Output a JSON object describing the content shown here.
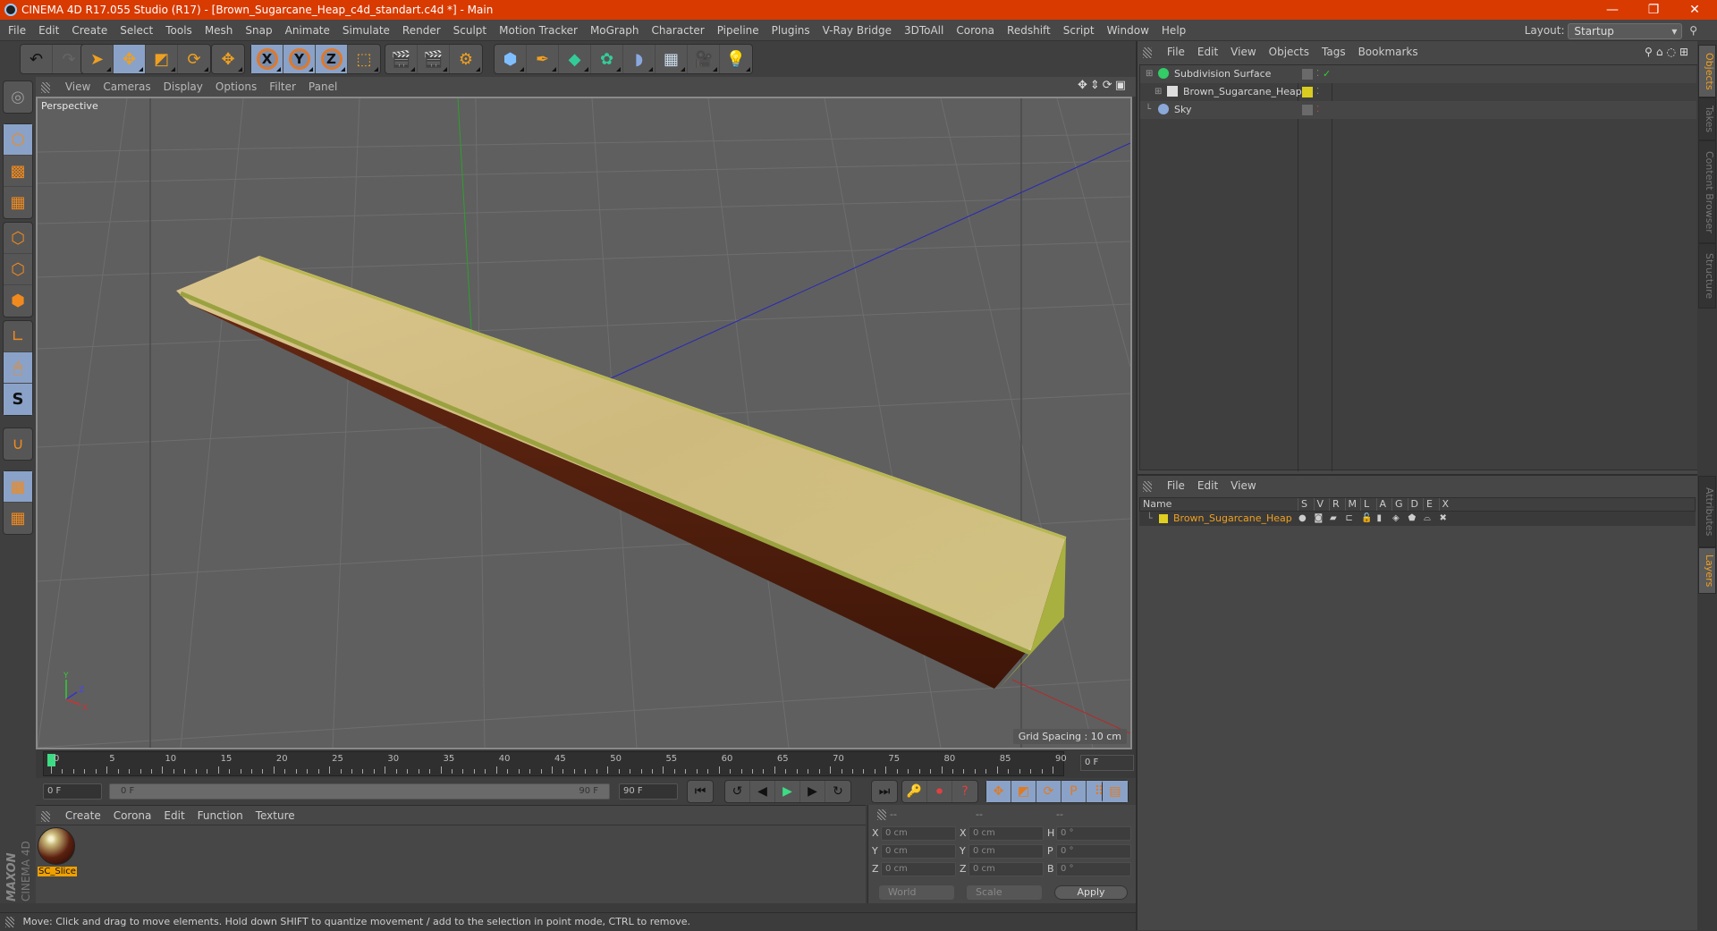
{
  "window": {
    "title": "CINEMA 4D R17.055 Studio (R17) - [Brown_Sugarcane_Heap_c4d_standart.c4d *] - Main",
    "controls": {
      "minimize": "—",
      "restore": "❐",
      "close": "✕"
    }
  },
  "menubar": {
    "items": [
      "File",
      "Edit",
      "Create",
      "Select",
      "Tools",
      "Mesh",
      "Snap",
      "Animate",
      "Simulate",
      "Render",
      "Sculpt",
      "Motion Tracker",
      "MoGraph",
      "Character",
      "Pipeline",
      "Plugins",
      "V-Ray Bridge",
      "3DToAll",
      "Corona",
      "Redshift",
      "Script",
      "Window",
      "Help"
    ],
    "layout_label": "Layout:",
    "layout_value": "Startup"
  },
  "toolbar": {
    "groups": [
      [
        {
          "icon": "undo-icon",
          "glyph": "↶"
        },
        {
          "icon": "redo-icon",
          "glyph": "↷"
        }
      ],
      [
        {
          "icon": "live-selection-icon",
          "glyph": "➤",
          "active": false
        },
        {
          "icon": "move-icon",
          "glyph": "✥",
          "active": true
        },
        {
          "icon": "scale-icon",
          "glyph": "◩",
          "active": false
        },
        {
          "icon": "rotate-icon",
          "glyph": "⟳",
          "active": false
        }
      ],
      [
        {
          "icon": "recent-tool-icon",
          "glyph": "✥"
        }
      ],
      [
        {
          "icon": "x-axis-lock-icon",
          "glyph": "X",
          "active": true
        },
        {
          "icon": "y-axis-lock-icon",
          "glyph": "Y",
          "active": true
        },
        {
          "icon": "z-axis-lock-icon",
          "glyph": "Z",
          "active": true
        },
        {
          "icon": "coordinate-system-icon",
          "glyph": "⬚"
        }
      ],
      [
        {
          "icon": "render-view-icon",
          "glyph": "🎬"
        },
        {
          "icon": "render-picture-viewer-icon",
          "glyph": "🎬"
        },
        {
          "icon": "render-settings-icon",
          "glyph": "⚙"
        }
      ],
      [
        {
          "icon": "cube-icon",
          "glyph": "⬢"
        },
        {
          "icon": "pen-spline-icon",
          "glyph": "✒"
        },
        {
          "icon": "subdivision-surface-icon",
          "glyph": "◆"
        },
        {
          "icon": "cloner-icon",
          "glyph": "✿"
        },
        {
          "icon": "deformer-bend-icon",
          "glyph": "◗"
        },
        {
          "icon": "floor-icon",
          "glyph": "▦"
        },
        {
          "icon": "camera-icon",
          "glyph": "🎥"
        },
        {
          "icon": "light-icon",
          "glyph": "💡"
        }
      ]
    ]
  },
  "left_tools": {
    "groups": [
      [
        {
          "icon": "make-editable-icon",
          "glyph": "◎"
        }
      ],
      [
        {
          "icon": "model-mode-icon",
          "glyph": "⬡",
          "active": true
        },
        {
          "icon": "texture-mode-icon",
          "glyph": "▩"
        },
        {
          "icon": "workplane-mode-icon",
          "glyph": "▦"
        }
      ],
      [
        {
          "icon": "points-mode-icon",
          "glyph": "⬡"
        },
        {
          "icon": "edges-mode-icon",
          "glyph": "⬡"
        },
        {
          "icon": "polygons-mode-icon",
          "glyph": "⬢"
        }
      ],
      [
        {
          "icon": "axis-mode-icon",
          "glyph": "∟"
        },
        {
          "icon": "tweak-mode-icon",
          "glyph": "🖱",
          "active": true
        },
        {
          "icon": "snapping-icon",
          "glyph": "S",
          "active": true
        }
      ],
      [
        {
          "icon": "magnet-icon",
          "glyph": "∪"
        }
      ],
      [
        {
          "icon": "locked-workplane-icon",
          "glyph": "▦",
          "active": true
        },
        {
          "icon": "planar-workplane-icon",
          "glyph": "▦"
        }
      ]
    ]
  },
  "viewport": {
    "menu": [
      "View",
      "Cameras",
      "Display",
      "Options",
      "Filter",
      "Panel"
    ],
    "label": "Perspective",
    "grid_spacing": "Grid Spacing : 10 cm",
    "nav_icons": [
      "move-view-icon",
      "zoom-view-icon",
      "rotate-view-icon",
      "maximize-view-icon"
    ],
    "axis_labels": {
      "x": "X",
      "y": "Y",
      "z": "Z"
    }
  },
  "timeline": {
    "ticks": [
      "0",
      "5",
      "10",
      "15",
      "20",
      "25",
      "30",
      "35",
      "40",
      "45",
      "50",
      "55",
      "60",
      "65",
      "70",
      "75",
      "80",
      "85",
      "90"
    ],
    "current_frame": "0 F",
    "start_field": "0 F",
    "range_start": "0 F",
    "range_end": "90 F",
    "end_field": "90 F"
  },
  "transport": {
    "buttons": [
      {
        "name": "go-to-start-button",
        "glyph": "⏮"
      },
      {
        "name": "previous-keyframe-button",
        "glyph": "↺"
      },
      {
        "name": "previous-frame-button",
        "glyph": "◀"
      },
      {
        "name": "play-button",
        "glyph": "▶"
      },
      {
        "name": "next-frame-button",
        "glyph": "▶"
      },
      {
        "name": "next-keyframe-button",
        "glyph": "↻"
      },
      {
        "name": "go-to-end-button",
        "glyph": "⏭"
      },
      {
        "name": "record-motion-button",
        "glyph": "🔑"
      },
      {
        "name": "autokeying-button",
        "glyph": "⏺"
      },
      {
        "name": "keyframe-selection-button",
        "glyph": "?"
      },
      {
        "name": "key-position-button",
        "glyph": "✥"
      },
      {
        "name": "key-scale-button",
        "glyph": "◩"
      },
      {
        "name": "key-rotation-button",
        "glyph": "⟳"
      },
      {
        "name": "key-parameter-button",
        "glyph": "P"
      },
      {
        "name": "key-pla-button",
        "glyph": "⠿"
      },
      {
        "name": "timeline-button",
        "glyph": "▤"
      }
    ]
  },
  "material_manager": {
    "menu": [
      "Create",
      "Corona",
      "Edit",
      "Function",
      "Texture"
    ],
    "materials": [
      {
        "name": "SC_Slice"
      }
    ]
  },
  "coordinates": {
    "headers": [
      "--",
      "--",
      "--"
    ],
    "rows": [
      {
        "l1": "X",
        "v1": "0 cm",
        "l2": "X",
        "v2": "0 cm",
        "l3": "H",
        "v3": "0 °"
      },
      {
        "l1": "Y",
        "v1": "0 cm",
        "l2": "Y",
        "v2": "0 cm",
        "l3": "P",
        "v3": "0 °"
      },
      {
        "l1": "Z",
        "v1": "0 cm",
        "l2": "Z",
        "v2": "0 cm",
        "l3": "B",
        "v3": "0 °"
      }
    ],
    "mode": "World",
    "transform": "Scale",
    "apply": "Apply"
  },
  "logo": {
    "brand": "MAXON",
    "product": "CINEMA 4D"
  },
  "status": "Move: Click and drag to move elements. Hold down SHIFT to quantize movement / add to the selection in point mode, CTRL to remove.",
  "object_manager": {
    "menu": [
      "File",
      "Edit",
      "View",
      "Objects",
      "Tags",
      "Bookmarks"
    ],
    "objects": [
      {
        "name": "Subdivision Surface",
        "icon": "subdivision-surface-icon",
        "color": "#33cc66",
        "check": "✓"
      },
      {
        "name": "Brown_Sugarcane_Heap",
        "icon": "null-object-icon",
        "color": "#ddd",
        "tag_color": "#d8cc20"
      },
      {
        "name": "Sky",
        "icon": "sky-icon",
        "color": "#8aa8d8"
      }
    ]
  },
  "layer_manager": {
    "menu": [
      "File",
      "Edit",
      "View"
    ],
    "columns": [
      "Name",
      "S",
      "V",
      "R",
      "M",
      "L",
      "A",
      "G",
      "D",
      "E",
      "X"
    ],
    "layers": [
      {
        "name": "Brown_Sugarcane_Heap",
        "color": "#e0d020"
      }
    ]
  },
  "side_tabs": {
    "top": [
      {
        "label": "Objects",
        "active": true
      },
      {
        "label": "Takes"
      },
      {
        "label": "Content Browser"
      },
      {
        "label": "Structure"
      }
    ],
    "bottom": [
      {
        "label": "Attributes"
      },
      {
        "label": "Layers",
        "active": true
      }
    ]
  },
  "colors": {
    "title_bar": "#d93a00",
    "accent": "#f0a020",
    "active_tool": "#8aa2c8"
  }
}
